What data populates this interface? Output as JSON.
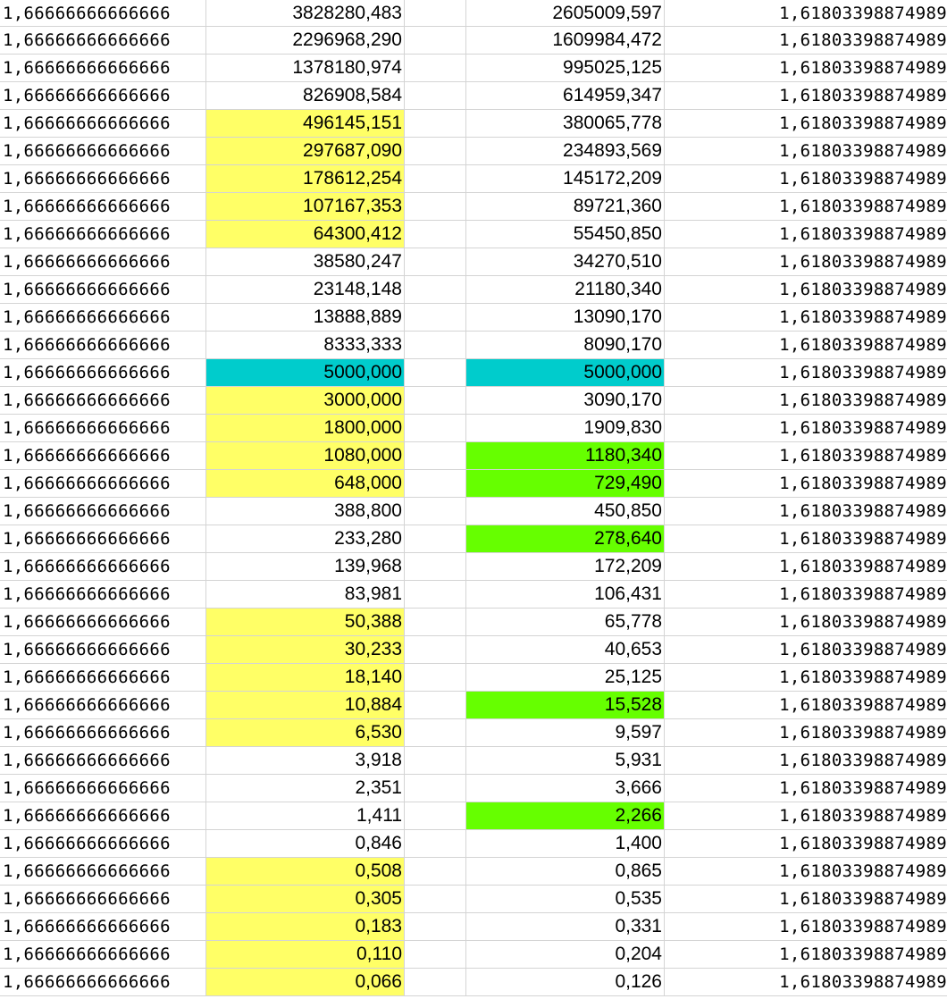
{
  "colors": {
    "yellow": "#ffff66",
    "cyan": "#00cccc",
    "green": "#66ff00",
    "grid": "#d4d4d4"
  },
  "rows": [
    {
      "a": "1,66666666666666",
      "b": "3828280,483",
      "bh": "",
      "d": "2605009,597",
      "dh": "",
      "e": "1,61803398874989"
    },
    {
      "a": "1,66666666666666",
      "b": "2296968,290",
      "bh": "",
      "d": "1609984,472",
      "dh": "",
      "e": "1,61803398874989"
    },
    {
      "a": "1,66666666666666",
      "b": "1378180,974",
      "bh": "",
      "d": "995025,125",
      "dh": "",
      "e": "1,61803398874989"
    },
    {
      "a": "1,66666666666666",
      "b": "826908,584",
      "bh": "",
      "d": "614959,347",
      "dh": "",
      "e": "1,61803398874989"
    },
    {
      "a": "1,66666666666666",
      "b": "496145,151",
      "bh": "yellow",
      "d": "380065,778",
      "dh": "",
      "e": "1,61803398874989"
    },
    {
      "a": "1,66666666666666",
      "b": "297687,090",
      "bh": "yellow",
      "d": "234893,569",
      "dh": "",
      "e": "1,61803398874989"
    },
    {
      "a": "1,66666666666666",
      "b": "178612,254",
      "bh": "yellow",
      "d": "145172,209",
      "dh": "",
      "e": "1,61803398874989"
    },
    {
      "a": "1,66666666666666",
      "b": "107167,353",
      "bh": "yellow",
      "d": "89721,360",
      "dh": "",
      "e": "1,61803398874989"
    },
    {
      "a": "1,66666666666666",
      "b": "64300,412",
      "bh": "yellow",
      "d": "55450,850",
      "dh": "",
      "e": "1,61803398874989"
    },
    {
      "a": "1,66666666666666",
      "b": "38580,247",
      "bh": "",
      "d": "34270,510",
      "dh": "",
      "e": "1,61803398874989"
    },
    {
      "a": "1,66666666666666",
      "b": "23148,148",
      "bh": "",
      "d": "21180,340",
      "dh": "",
      "e": "1,61803398874989"
    },
    {
      "a": "1,66666666666666",
      "b": "13888,889",
      "bh": "",
      "d": "13090,170",
      "dh": "",
      "e": "1,61803398874989"
    },
    {
      "a": "1,66666666666666",
      "b": "8333,333",
      "bh": "",
      "d": "8090,170",
      "dh": "",
      "e": "1,61803398874989"
    },
    {
      "a": "1,66666666666666",
      "b": "5000,000",
      "bh": "cyan",
      "d": "5000,000",
      "dh": "cyan",
      "e": "1,61803398874989"
    },
    {
      "a": "1,66666666666666",
      "b": "3000,000",
      "bh": "yellow",
      "d": "3090,170",
      "dh": "",
      "e": "1,61803398874989"
    },
    {
      "a": "1,66666666666666",
      "b": "1800,000",
      "bh": "yellow",
      "d": "1909,830",
      "dh": "",
      "e": "1,61803398874989"
    },
    {
      "a": "1,66666666666666",
      "b": "1080,000",
      "bh": "yellow",
      "d": "1180,340",
      "dh": "green",
      "e": "1,61803398874989"
    },
    {
      "a": "1,66666666666666",
      "b": "648,000",
      "bh": "yellow",
      "d": "729,490",
      "dh": "green",
      "e": "1,61803398874989"
    },
    {
      "a": "1,66666666666666",
      "b": "388,800",
      "bh": "",
      "d": "450,850",
      "dh": "",
      "e": "1,61803398874989"
    },
    {
      "a": "1,66666666666666",
      "b": "233,280",
      "bh": "",
      "d": "278,640",
      "dh": "green",
      "e": "1,61803398874989"
    },
    {
      "a": "1,66666666666666",
      "b": "139,968",
      "bh": "",
      "d": "172,209",
      "dh": "",
      "e": "1,61803398874989"
    },
    {
      "a": "1,66666666666666",
      "b": "83,981",
      "bh": "",
      "d": "106,431",
      "dh": "",
      "e": "1,61803398874989"
    },
    {
      "a": "1,66666666666666",
      "b": "50,388",
      "bh": "yellow",
      "d": "65,778",
      "dh": "",
      "e": "1,61803398874989"
    },
    {
      "a": "1,66666666666666",
      "b": "30,233",
      "bh": "yellow",
      "d": "40,653",
      "dh": "",
      "e": "1,61803398874989"
    },
    {
      "a": "1,66666666666666",
      "b": "18,140",
      "bh": "yellow",
      "d": "25,125",
      "dh": "",
      "e": "1,61803398874989"
    },
    {
      "a": "1,66666666666666",
      "b": "10,884",
      "bh": "yellow",
      "d": "15,528",
      "dh": "green",
      "e": "1,61803398874989"
    },
    {
      "a": "1,66666666666666",
      "b": "6,530",
      "bh": "yellow",
      "d": "9,597",
      "dh": "",
      "e": "1,61803398874989"
    },
    {
      "a": "1,66666666666666",
      "b": "3,918",
      "bh": "",
      "d": "5,931",
      "dh": "",
      "e": "1,61803398874989"
    },
    {
      "a": "1,66666666666666",
      "b": "2,351",
      "bh": "",
      "d": "3,666",
      "dh": "",
      "e": "1,61803398874989"
    },
    {
      "a": "1,66666666666666",
      "b": "1,411",
      "bh": "",
      "d": "2,266",
      "dh": "green",
      "e": "1,61803398874989"
    },
    {
      "a": "1,66666666666666",
      "b": "0,846",
      "bh": "",
      "d": "1,400",
      "dh": "",
      "e": "1,61803398874989"
    },
    {
      "a": "1,66666666666666",
      "b": "0,508",
      "bh": "yellow",
      "d": "0,865",
      "dh": "",
      "e": "1,61803398874989"
    },
    {
      "a": "1,66666666666666",
      "b": "0,305",
      "bh": "yellow",
      "d": "0,535",
      "dh": "",
      "e": "1,61803398874989"
    },
    {
      "a": "1,66666666666666",
      "b": "0,183",
      "bh": "yellow",
      "d": "0,331",
      "dh": "",
      "e": "1,61803398874989"
    },
    {
      "a": "1,66666666666666",
      "b": "0,110",
      "bh": "yellow",
      "d": "0,204",
      "dh": "",
      "e": "1,61803398874989"
    },
    {
      "a": "1,66666666666666",
      "b": "0,066",
      "bh": "yellow",
      "d": "0,126",
      "dh": "",
      "e": "1,61803398874989"
    }
  ]
}
